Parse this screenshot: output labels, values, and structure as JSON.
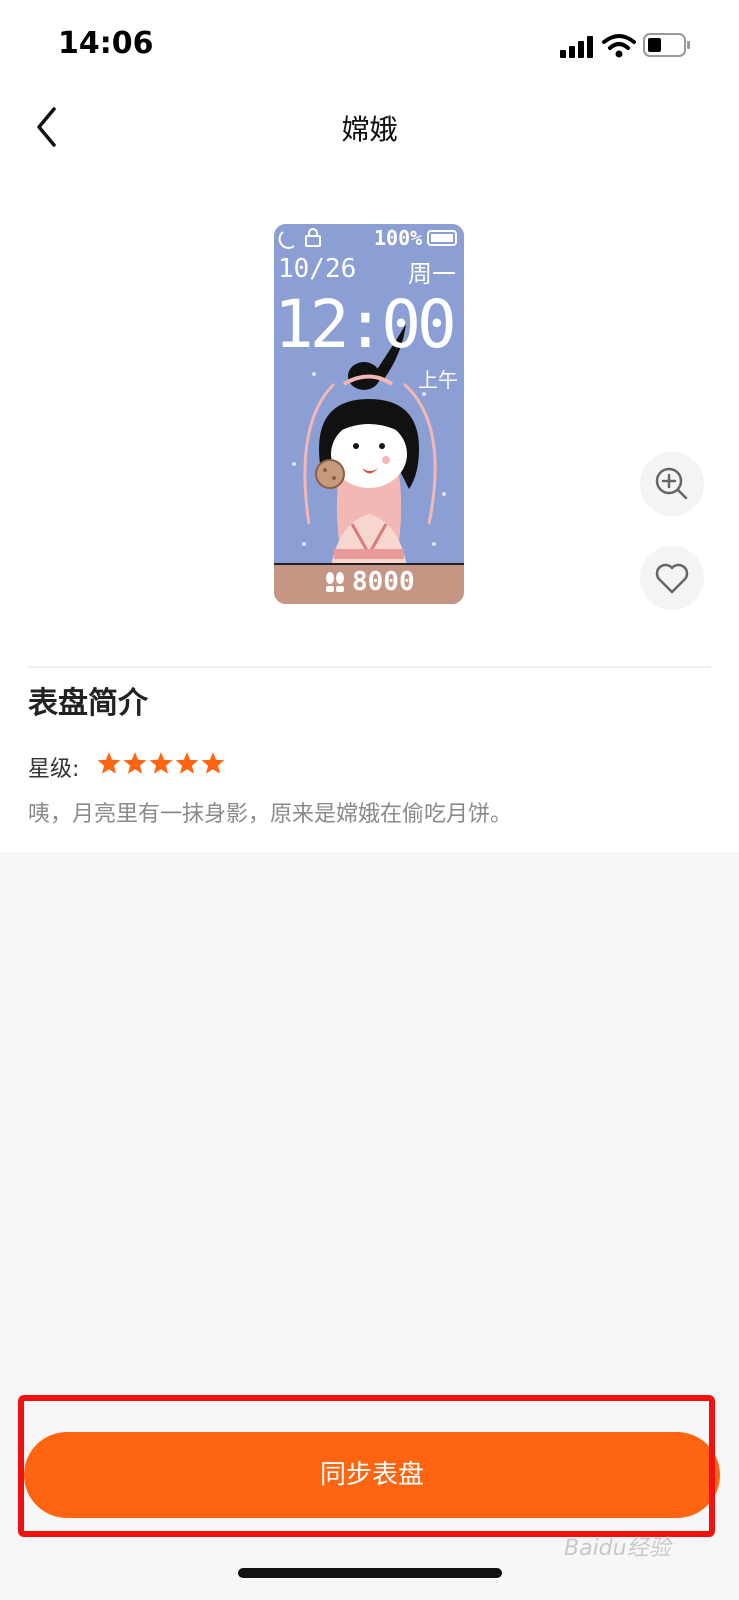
{
  "status_bar": {
    "time": "14:06"
  },
  "nav": {
    "title": "嫦娥"
  },
  "preview": {
    "battery": "100%",
    "date": "10/26",
    "weekday": "周一",
    "time": "12:00",
    "ampm": "上午",
    "steps": "8000"
  },
  "intro": {
    "title": "表盘简介",
    "rating_label": "星级:",
    "rating": 5,
    "description": "咦，月亮里有一抹身影，原来是嫦娥在偷吃月饼。"
  },
  "sync_button": {
    "label": "同步表盘"
  },
  "watermark": {
    "text": "Baidu经验"
  },
  "colors": {
    "accent": "#ff6410",
    "highlight": "#f01111",
    "face_bg": "#8c9fd4"
  }
}
